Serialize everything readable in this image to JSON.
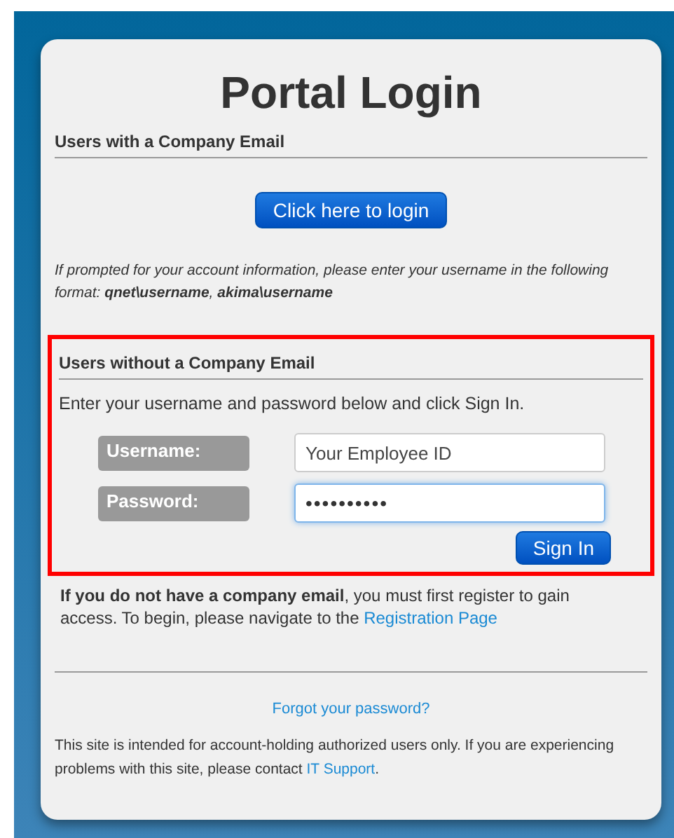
{
  "title": "Portal Login",
  "company_section": {
    "heading": "Users with a Company Email",
    "button": "Click here to login",
    "note": "If prompted for your account information, please enter your username in the following format: **qnet\\username**, **akima\\username**"
  },
  "local_section": {
    "heading": "Users without a Company Email",
    "highlighted": true,
    "intro": "Enter your username and password below and click Sign In.",
    "fields": [
      {
        "label": "Username:",
        "placeholder": "Your Employee ID",
        "focused": false
      },
      {
        "label": "Password:",
        "value": "••••••••••",
        "focused": true
      }
    ],
    "button": "Sign In"
  },
  "register_note": {
    "text": "**If you do not have a company email**, you must first register to gain access. To begin, please navigate to the",
    "link": "Registration Page"
  },
  "forgot_link": "Forgot your password?",
  "footer": {
    "text": "This site is intended for account-holding authorized users only. If you are experiencing problems with this site, please contact",
    "link": "IT Support",
    "after": "."
  }
}
